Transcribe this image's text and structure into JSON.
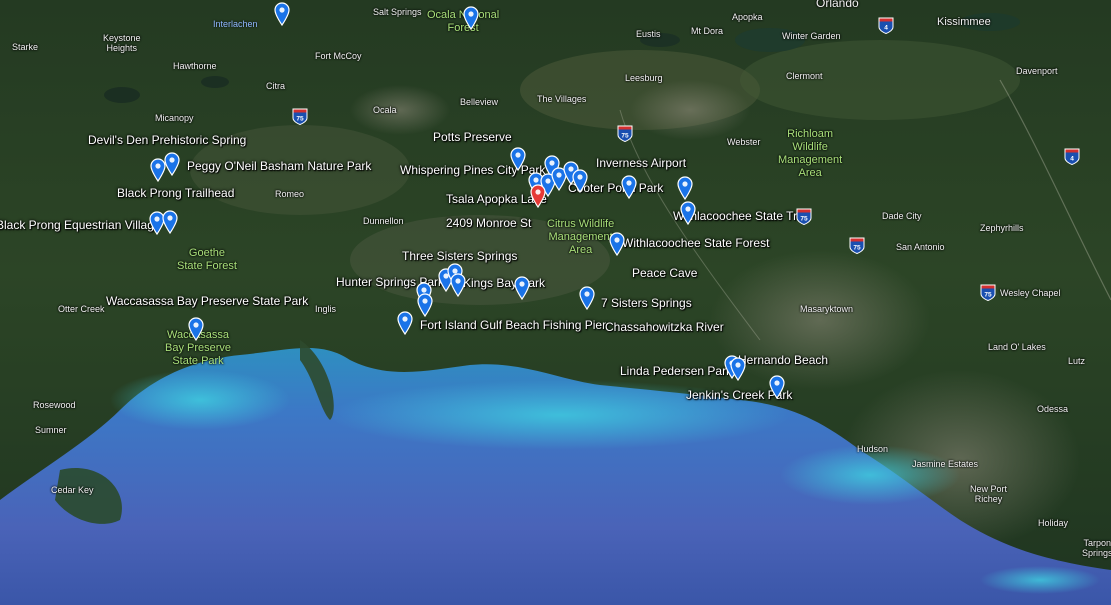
{
  "colors": {
    "pin_blue": "#1a73e8",
    "pin_red": "#e53935",
    "park_green": "#a9e07a",
    "label_white": "#ffffff",
    "water_blue": "#3f6fc4",
    "shallow_teal": "#2ec0d8",
    "interstate_blue": "#1a4fb0"
  },
  "towns": {
    "salt_springs": "Salt Springs",
    "orlando": "Orlando",
    "kissimmee": "Kissimmee",
    "starke": "Starke",
    "keystone_heights": "Keystone\nHeights",
    "eustis": "Eustis",
    "mt_dora": "Mt Dora",
    "apopka": "Apopka",
    "winter_garden": "Winter Garden",
    "fort_mccoy": "Fort McCoy",
    "hawthorne": "Hawthorne",
    "leesburg": "Leesburg",
    "clermont": "Clermont",
    "davenport": "Davenport",
    "citra": "Citra",
    "micanopy": "Micanopy",
    "ocala": "Ocala",
    "belleview": "Belleview",
    "the_villages": "The Villages",
    "webster": "Webster",
    "romeo": "Romeo",
    "dunnellon": "Dunnellon",
    "dade_city": "Dade City",
    "zephyrhills": "Zephyrhills",
    "san_antonio": "San Antonio",
    "otter_creek": "Otter Creek",
    "inglis": "Inglis",
    "masaryktown": "Masaryktown",
    "wesley_chapel": "Wesley Chapel",
    "land_o_lakes": "Land O' Lakes",
    "lutz": "Lutz",
    "rosewood": "Rosewood",
    "sumner": "Sumner",
    "odessa": "Odessa",
    "hudson": "Hudson",
    "jasmine_estates": "Jasmine Estates",
    "cedar_key": "Cedar Key",
    "new_port_richey": "New Port\nRichey",
    "holiday": "Holiday",
    "tarpon_springs": "Tarpon\nSprings"
  },
  "water_labels": {
    "interlachen": "Interlachen"
  },
  "green_labels": {
    "ocala_national_forest": "Ocala National\nForest",
    "richloam": "Richloam\nWildlife\nManagement\nArea",
    "citrus_wildlife": "Citrus Wildlife\nManagement\nArea",
    "goethe": "Goethe\nState Forest",
    "waccasassa_green": "Waccasassa\nBay Preserve\nState Park"
  },
  "places": {
    "devils_den": "Devil's Den Prehistoric Spring",
    "peggy_onell": "Peggy O'Neil Basham Nature Park",
    "black_prong_trailhead": "Black Prong Trailhead",
    "black_prong_equestrian": "Black Prong Equestrian Village",
    "potts_preserve": "Potts Preserve",
    "whispering_pines": "Whispering Pines City Park",
    "inverness_airport": "Inverness Airport",
    "cooter_pond": "Cooter Pond Park",
    "tsala_apopka": "Tsala Apopka Lake",
    "monroe_st": "2409 Monroe St",
    "withlacoochee_trail": "Withlacoochee State Trail",
    "withlacoochee_forest": "Withlacoochee State Forest",
    "three_sisters": "Three Sisters Springs",
    "peace_cave": "Peace Cave",
    "hunter_springs": "Hunter Springs Park",
    "kings_bay": "Kings Bay Park",
    "waccasassa_white": "Waccasassa Bay Preserve State Park",
    "seven_sisters": "7 Sisters Springs",
    "fort_island": "Fort Island Gulf Beach Fishing Pier",
    "chassahowitzka": "Chassahowitzka River",
    "linda_pedersen": "Linda Pedersen Park",
    "hernando_beach": "Hernando Beach",
    "jenkins_creek": "Jenkin's Creek Park"
  },
  "interstate_shields": [
    {
      "route": "75"
    },
    {
      "route": "75"
    },
    {
      "route": "75"
    },
    {
      "route": "75"
    },
    {
      "route": "75"
    },
    {
      "route": "4"
    },
    {
      "route": "4"
    }
  ]
}
